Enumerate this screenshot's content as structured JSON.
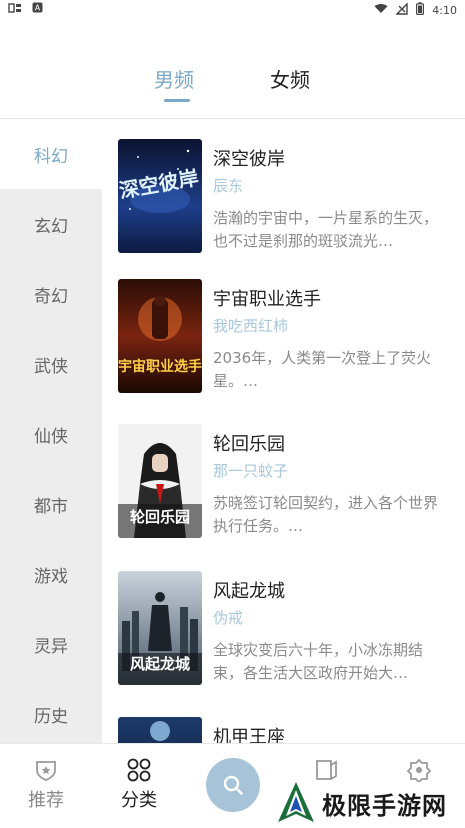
{
  "status_bar": {
    "left_icons": [
      "app-icon-1",
      "app-icon-2"
    ],
    "time": "4:10"
  },
  "gender_tabs": [
    {
      "label": "男频",
      "active": true
    },
    {
      "label": "女频",
      "active": false
    }
  ],
  "categories": [
    {
      "label": "科幻",
      "active": true
    },
    {
      "label": "玄幻"
    },
    {
      "label": "奇幻"
    },
    {
      "label": "武侠"
    },
    {
      "label": "仙侠"
    },
    {
      "label": "都市"
    },
    {
      "label": "游戏"
    },
    {
      "label": "灵异"
    },
    {
      "label": "历史"
    }
  ],
  "books": [
    {
      "title": "深空彼岸",
      "author": "辰东",
      "desc": "浩瀚的宇宙中，一片星系的生灭，也不过是刹那的斑驳流光…",
      "cover_text": "深空彼岸"
    },
    {
      "title": "宇宙职业选手",
      "author": "我吃西红柿",
      "desc": "2036年，人类第一次登上了荧火星。…",
      "cover_text": "宇宙职业选手"
    },
    {
      "title": "轮回乐园",
      "author": "那一只蚊子",
      "desc": "苏晓签订轮回契约，进入各个世界执行任务。…",
      "cover_text": "轮回乐园"
    },
    {
      "title": "风起龙城",
      "author": "伪戒",
      "desc": "全球灾变后六十年，小冰冻期结束，各生活大区政府开始大…",
      "cover_text": "风起龙城"
    },
    {
      "title": "机甲王座",
      "author": "",
      "desc": "",
      "cover_text": ""
    }
  ],
  "bottom_nav": {
    "recommend_label": "推荐",
    "category_label": "分类",
    "search_icon": "search-icon"
  },
  "watermark": {
    "text": "极限手游网"
  },
  "colors": {
    "accent": "#7aa8c8",
    "author": "#a8c8dd",
    "sidebar_bg": "#ededed",
    "fab": "#a7c3d8"
  }
}
